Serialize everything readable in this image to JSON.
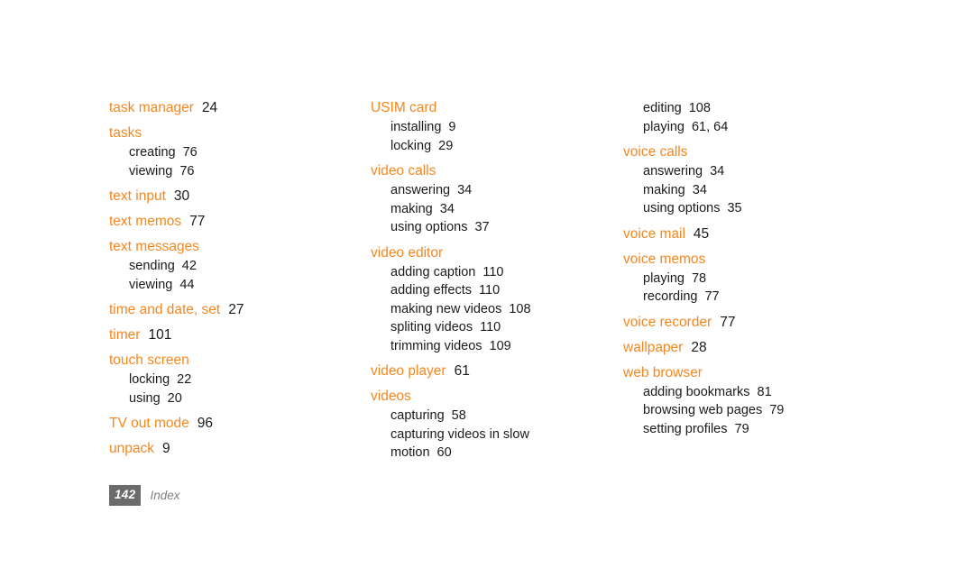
{
  "document": {
    "type": "index",
    "accent_color": "#f5871f",
    "text_color": "#1a1a1a",
    "background_color": "#ffffff"
  },
  "columns": [
    {
      "id": "column-1",
      "entries": [
        {
          "kind": "main",
          "term": "task manager",
          "page": "24"
        },
        {
          "kind": "main",
          "term": "tasks",
          "page": ""
        },
        {
          "kind": "sub",
          "term": "creating",
          "page": "76"
        },
        {
          "kind": "sub",
          "term": "viewing",
          "page": "76"
        },
        {
          "kind": "main",
          "term": "text input",
          "page": "30"
        },
        {
          "kind": "main",
          "term": "text memos",
          "page": "77"
        },
        {
          "kind": "main",
          "term": "text messages",
          "page": ""
        },
        {
          "kind": "sub",
          "term": "sending",
          "page": "42"
        },
        {
          "kind": "sub",
          "term": "viewing",
          "page": "44"
        },
        {
          "kind": "main",
          "term": "time and date, set",
          "page": "27"
        },
        {
          "kind": "main",
          "term": "timer",
          "page": "101"
        },
        {
          "kind": "main",
          "term": "touch screen",
          "page": ""
        },
        {
          "kind": "sub",
          "term": "locking",
          "page": "22"
        },
        {
          "kind": "sub",
          "term": "using",
          "page": "20"
        },
        {
          "kind": "main",
          "term": "TV out mode",
          "page": "96"
        },
        {
          "kind": "main",
          "term": "unpack",
          "page": "9"
        }
      ]
    },
    {
      "id": "column-2",
      "entries": [
        {
          "kind": "main",
          "term": "USIM card",
          "page": ""
        },
        {
          "kind": "sub",
          "term": "installing",
          "page": "9"
        },
        {
          "kind": "sub",
          "term": "locking",
          "page": "29"
        },
        {
          "kind": "main",
          "term": "video calls",
          "page": ""
        },
        {
          "kind": "sub",
          "term": "answering",
          "page": "34"
        },
        {
          "kind": "sub",
          "term": "making",
          "page": "34"
        },
        {
          "kind": "sub",
          "term": "using options",
          "page": "37"
        },
        {
          "kind": "main",
          "term": "video editor",
          "page": ""
        },
        {
          "kind": "sub",
          "term": "adding caption",
          "page": "110"
        },
        {
          "kind": "sub",
          "term": "adding effects",
          "page": "110"
        },
        {
          "kind": "sub",
          "term": "making new videos",
          "page": "108"
        },
        {
          "kind": "sub",
          "term": "spliting videos",
          "page": "110"
        },
        {
          "kind": "sub",
          "term": "trimming videos",
          "page": "109"
        },
        {
          "kind": "main",
          "term": "video player",
          "page": "61"
        },
        {
          "kind": "main",
          "term": "videos",
          "page": ""
        },
        {
          "kind": "sub",
          "term": "capturing",
          "page": "58"
        },
        {
          "kind": "sub",
          "term": "capturing videos in slow",
          "page": ""
        },
        {
          "kind": "sub",
          "term": "motion",
          "page": "60"
        }
      ]
    },
    {
      "id": "column-3",
      "entries": [
        {
          "kind": "sub",
          "term": "editing",
          "page": "108"
        },
        {
          "kind": "sub",
          "term": "playing",
          "page": "61, 64"
        },
        {
          "kind": "main",
          "term": "voice calls",
          "page": ""
        },
        {
          "kind": "sub",
          "term": "answering",
          "page": "34"
        },
        {
          "kind": "sub",
          "term": "making",
          "page": "34"
        },
        {
          "kind": "sub",
          "term": "using options",
          "page": "35"
        },
        {
          "kind": "main",
          "term": "voice mail",
          "page": "45"
        },
        {
          "kind": "main",
          "term": "voice memos",
          "page": ""
        },
        {
          "kind": "sub",
          "term": "playing",
          "page": "78"
        },
        {
          "kind": "sub",
          "term": "recording",
          "page": "77"
        },
        {
          "kind": "main",
          "term": "voice recorder",
          "page": "77"
        },
        {
          "kind": "main",
          "term": "wallpaper",
          "page": "28"
        },
        {
          "kind": "main",
          "term": "web browser",
          "page": ""
        },
        {
          "kind": "sub",
          "term": "adding bookmarks",
          "page": "81"
        },
        {
          "kind": "sub",
          "term": "browsing web pages",
          "page": "79"
        },
        {
          "kind": "sub",
          "term": "setting profiles",
          "page": "79"
        }
      ]
    }
  ],
  "footer": {
    "page_number": "142",
    "section_label": "Index"
  }
}
